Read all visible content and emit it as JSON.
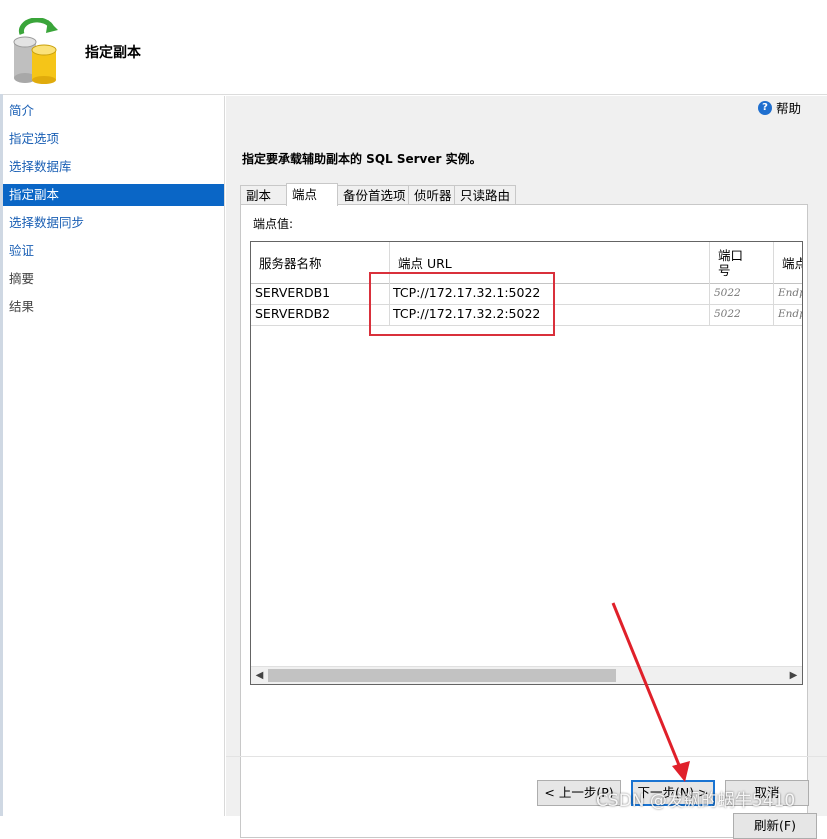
{
  "header": {
    "title": "指定副本"
  },
  "sidebar": {
    "items": [
      {
        "label": "简介"
      },
      {
        "label": "指定选项"
      },
      {
        "label": "选择数据库"
      },
      {
        "label": "指定副本"
      },
      {
        "label": "选择数据同步"
      },
      {
        "label": "验证"
      },
      {
        "label": "摘要"
      },
      {
        "label": "结果"
      }
    ],
    "active_index": 3
  },
  "main": {
    "help_label": "帮助",
    "instruction": "指定要承载辅助副本的 SQL Server 实例。",
    "tabs": [
      {
        "label": "副本"
      },
      {
        "label": "端点"
      },
      {
        "label": "备份首选项"
      },
      {
        "label": "侦听器"
      },
      {
        "label": "只读路由"
      }
    ],
    "active_tab": 1,
    "panel_label": "端点值:",
    "grid": {
      "columns": [
        {
          "label": "服务器名称"
        },
        {
          "label": "端点 URL"
        },
        {
          "label": "端口\n号"
        },
        {
          "label": "端点"
        }
      ],
      "rows": [
        {
          "server": "SERVERDB1",
          "url": "TCP://172.17.32.1:5022",
          "port": "5022",
          "endpoint": "Endp"
        },
        {
          "server": "SERVERDB2",
          "url": "TCP://172.17.32.2:5022",
          "port": "5022",
          "endpoint": "Endp"
        }
      ]
    },
    "refresh_label": "刷新(F)"
  },
  "footer": {
    "back_label": "< 上一步(P)",
    "next_label": "下一步(N) >",
    "cancel_label": "取消"
  },
  "watermark": "CSDN @发飙的蜗牛5410",
  "colors": {
    "active_nav": "#0a66c6",
    "link": "#1a5fb4",
    "annotation_red": "#d9303b",
    "focus_blue": "#1a74d2"
  }
}
